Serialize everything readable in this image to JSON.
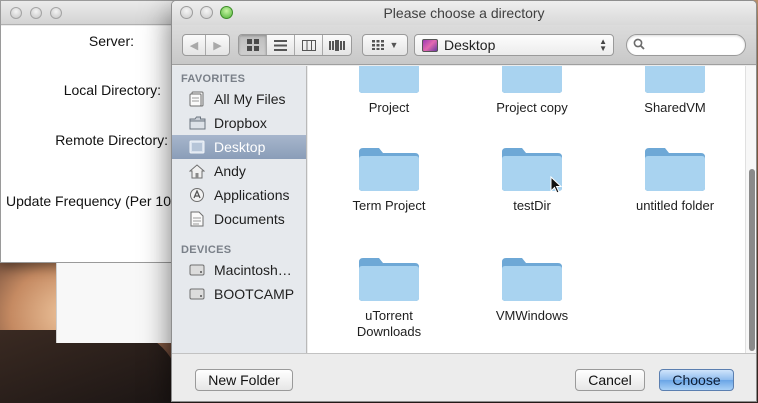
{
  "background_window": {
    "labels": [
      "Server:",
      "Local Directory:",
      "Remote Directory:",
      "Update Frequency (Per 10"
    ]
  },
  "dialog": {
    "title": "Please choose a directory",
    "toolbar": {
      "back_icon": "back-arrow-icon",
      "forward_icon": "forward-arrow-icon",
      "view_modes": [
        "icon-view",
        "list-view",
        "column-view",
        "coverflow-view"
      ],
      "active_view": "icon-view",
      "arrange_icon": "arrange-grid-icon",
      "location": "Desktop",
      "search_placeholder": ""
    },
    "sidebar": {
      "favorites_header": "FAVORITES",
      "favorites": [
        {
          "label": "All My Files",
          "icon": "all-files-icon"
        },
        {
          "label": "Dropbox",
          "icon": "folder-icon"
        },
        {
          "label": "Desktop",
          "icon": "desktop-icon",
          "selected": true
        },
        {
          "label": "Andy",
          "icon": "home-icon"
        },
        {
          "label": "Applications",
          "icon": "applications-icon"
        },
        {
          "label": "Documents",
          "icon": "documents-icon"
        }
      ],
      "devices_header": "DEVICES",
      "devices": [
        {
          "label": "Macintosh…",
          "icon": "harddrive-icon"
        },
        {
          "label": "BOOTCAMP",
          "icon": "harddrive-icon"
        }
      ]
    },
    "folders": [
      {
        "name": "Project"
      },
      {
        "name": "Project copy"
      },
      {
        "name": "SharedVM"
      },
      {
        "name": "Term Project"
      },
      {
        "name": "testDir"
      },
      {
        "name": "untitled folder"
      },
      {
        "name": "uTorrent Downloads"
      },
      {
        "name": "VMWindows"
      }
    ],
    "buttons": {
      "new_folder": "New Folder",
      "cancel": "Cancel",
      "choose": "Choose"
    },
    "colors": {
      "folder_light": "#a9d3f0",
      "folder_dark": "#6ea8d6",
      "sidebar_selected": "#8a9db8"
    }
  }
}
